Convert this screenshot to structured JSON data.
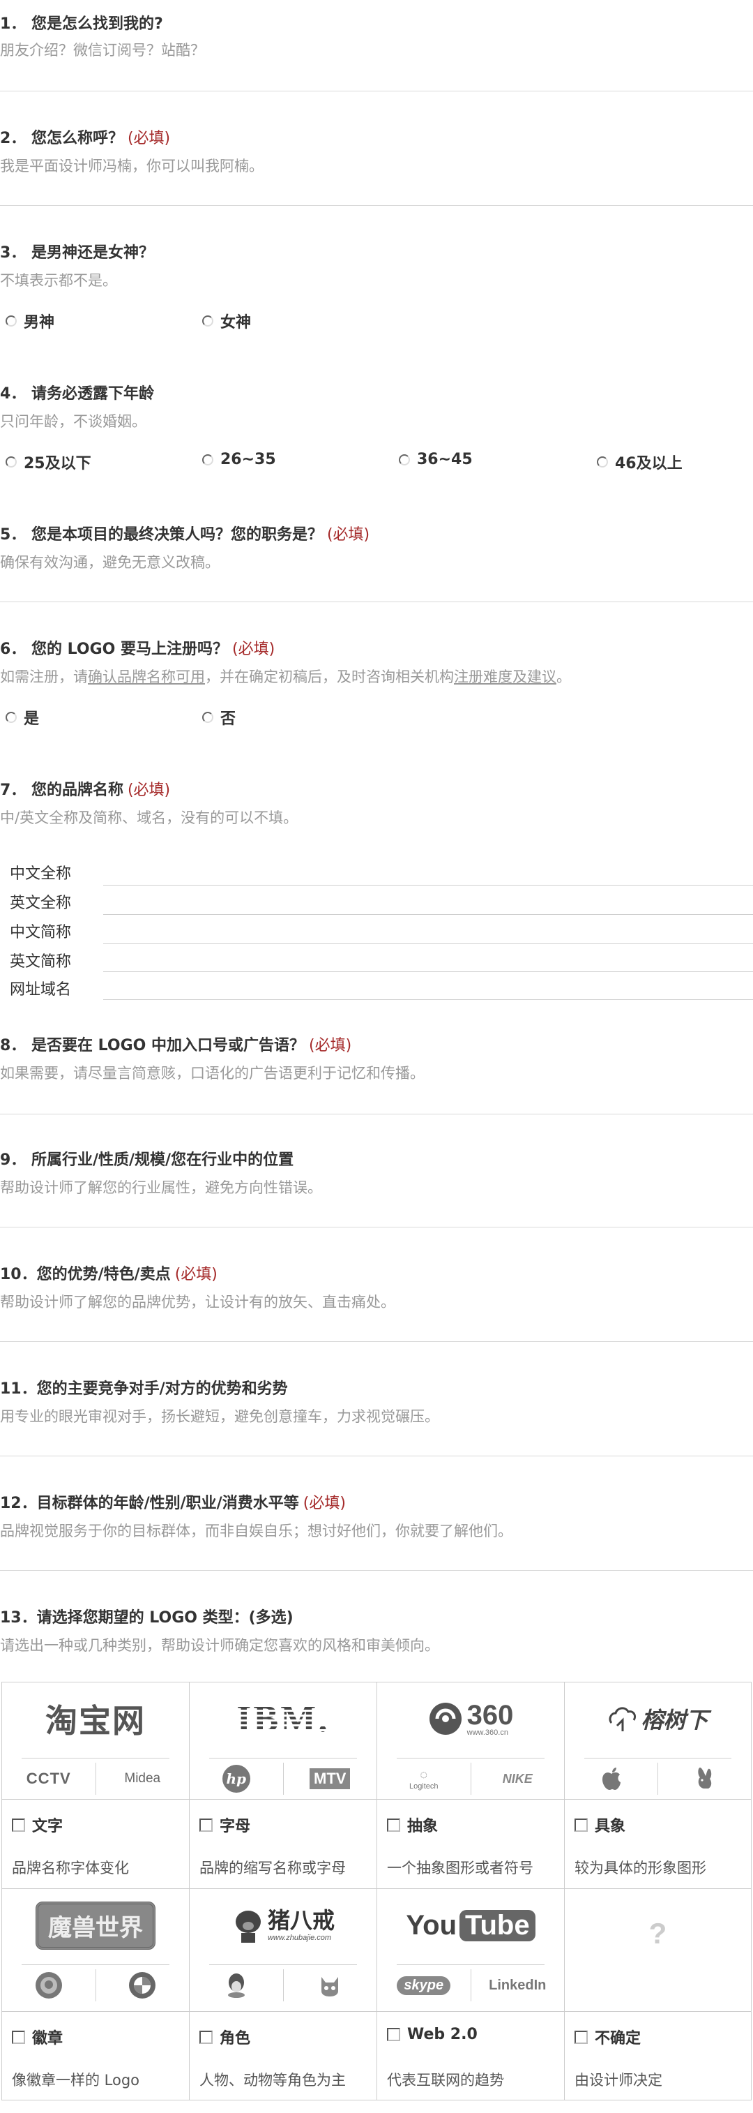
{
  "q1": {
    "title": "1．  您是怎么找到我的?",
    "hint": "朋友介绍？微信订阅号？站酷？"
  },
  "q2": {
    "title": "2．  您怎么称呼？",
    "required": "(必填)",
    "hint": "我是平面设计师冯楠，你可以叫我阿楠。"
  },
  "q3": {
    "title": "3．  是男神还是女神？",
    "hint": "不填表示都不是。",
    "options": [
      "男神",
      "女神"
    ]
  },
  "q4": {
    "title": "4．  请务必透露下年龄",
    "hint": "只问年龄，不谈婚姻。",
    "options": [
      "25及以下",
      "26~35",
      "36~45",
      "46及以上"
    ]
  },
  "q5": {
    "title": "5．  您是本项目的最终决策人吗？您的职务是？",
    "required": "(必填)",
    "hint": "确保有效沟通，避免无意义改稿。"
  },
  "q6": {
    "title": "6．  您的 LOGO 要马上注册吗？",
    "required": "(必填)",
    "hint_a": "如需注册，请",
    "hint_link1": "确认品牌名称可用",
    "hint_b": "，并在确定初稿后，及时咨询相关机构",
    "hint_link2": "注册难度及建议",
    "hint_c": "。",
    "options": [
      "是",
      "否"
    ]
  },
  "q7": {
    "title": "7．  您的品牌名称",
    "required": "(必填)",
    "hint": "中/英文全称及简称、域名，没有的可以不填。",
    "fields": [
      "中文全称",
      "英文全称",
      "中文简称",
      "英文简称",
      "网址域名"
    ]
  },
  "q8": {
    "title": "8．  是否要在 LOGO 中加入口号或广告语？",
    "required": "(必填)",
    "hint": "如果需要，请尽量言简意赅，口语化的广告语更利于记忆和传播。"
  },
  "q9": {
    "title": "9．  所属行业/性质/规模/您在行业中的位置",
    "hint": "帮助设计师了解您的行业属性，避免方向性错误。"
  },
  "q10": {
    "title": "10．您的优势/特色/卖点",
    "required": "(必填)",
    "hint": "帮助设计师了解您的品牌优势，让设计有的放矢、直击痛处。"
  },
  "q11": {
    "title": "11．您的主要竞争对手/对方的优势和劣势",
    "hint": "用专业的眼光审视对手，扬长避短，避免创意撞车，力求视觉碾压。"
  },
  "q12": {
    "title": "12．目标群体的年龄/性别/职业/消费水平等",
    "required": "(必填)",
    "hint": "品牌视觉服务于你的目标群体，而非自娱自乐；想讨好他们，你就要了解他们。"
  },
  "q13": {
    "title": "13．请选择您期望的 LOGO 类型：(多选)",
    "hint": "请选出一种或几种类别，帮助设计师确定您喜欢的风格和审美倾向。",
    "types": [
      {
        "label": "文字",
        "desc": "品牌名称字体变化",
        "logos": [
          "淘宝网",
          "CCTV",
          "Midea"
        ]
      },
      {
        "label": "字母",
        "desc": "品牌的缩写名称或字母",
        "logos": [
          "IBM.",
          "hp",
          "MTV"
        ]
      },
      {
        "label": "抽象",
        "desc": "一个抽象图形或者符号",
        "logos": [
          "360",
          "www.360.cn",
          "Logitech",
          "NIKE"
        ]
      },
      {
        "label": "具象",
        "desc": "较为具体的形象图形",
        "logos": [
          "榕树下",
          "Apple",
          "Playboy"
        ]
      },
      {
        "label": "徽章",
        "desc": "像徽章一样的 Logo",
        "logos": [
          "魔兽世界",
          "Starbucks",
          "BMW"
        ]
      },
      {
        "label": "角色",
        "desc": "人物、动物等角色为主",
        "logos": [
          "猪八戒",
          "www.zhubajie.com",
          "QQ",
          "Tmall"
        ]
      },
      {
        "label": "Web 2.0",
        "desc": "代表互联网的趋势",
        "logos": [
          "You",
          "Tube",
          "skype",
          "LinkedIn"
        ]
      },
      {
        "label": "不确定",
        "desc": "由设计师决定",
        "logos": [
          "?"
        ]
      }
    ]
  },
  "colors": {
    "required": "#a52a2a",
    "hint": "#999999",
    "border": "#cccccc"
  }
}
